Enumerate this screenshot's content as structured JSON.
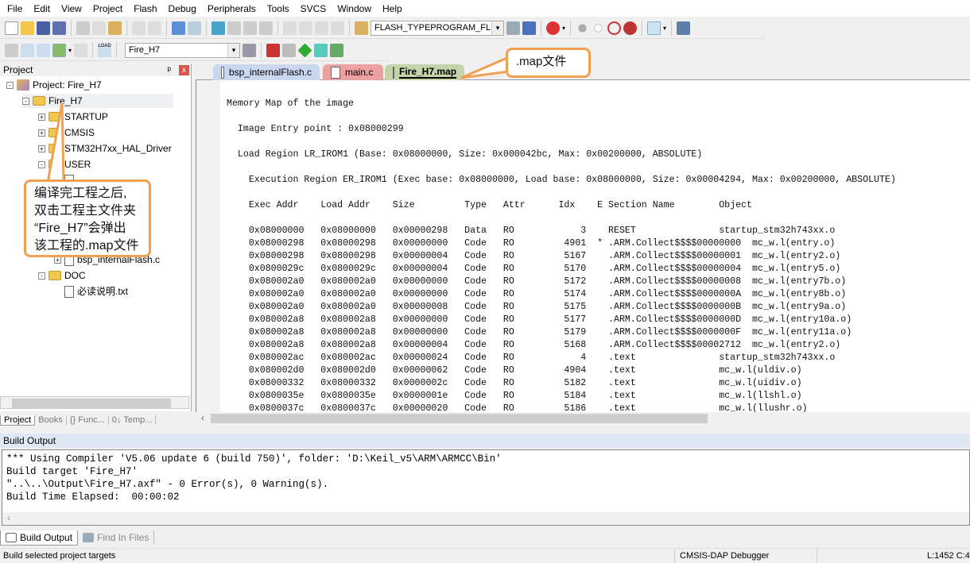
{
  "menu": [
    "File",
    "Edit",
    "View",
    "Project",
    "Flash",
    "Debug",
    "Peripherals",
    "Tools",
    "SVCS",
    "Window",
    "Help"
  ],
  "toolbar": {
    "flash_combo": "FLASH_TYPEPROGRAM_FL",
    "target_combo": "Fire_H7",
    "load_label": "LOAD"
  },
  "project_panel": {
    "title": "Project",
    "close": "x",
    "pin": "ᵖ",
    "items": [
      {
        "label": "Project: Fire_H7",
        "icon": "project-icon",
        "level": 0,
        "exp": "-"
      },
      {
        "label": "Fire_H7",
        "icon": "target-folder-icon",
        "level": 1,
        "exp": "-"
      },
      {
        "label": "STARTUP",
        "icon": "folder-icon",
        "level": 2,
        "exp": "+"
      },
      {
        "label": "CMSIS",
        "icon": "folder-icon",
        "level": 2,
        "exp": "+"
      },
      {
        "label": "STM32H7xx_HAL_Driver",
        "icon": "folder-icon",
        "level": 2,
        "exp": "+"
      },
      {
        "label": "USER",
        "icon": "folder-icon",
        "level": 2,
        "exp": "-"
      },
      {
        "label": "",
        "icon": "file-icon",
        "level": 3,
        "exp": ""
      },
      {
        "label": "",
        "icon": "file-icon",
        "level": 3,
        "exp": ""
      },
      {
        "label": "",
        "icon": "file-icon",
        "level": 3,
        "exp": ""
      },
      {
        "label": "",
        "icon": "file-icon",
        "level": 3,
        "exp": ""
      },
      {
        "label": "t.c",
        "icon": "file-icon",
        "level": 3,
        "exp": "+"
      },
      {
        "label": "bsp_internalFlash.c",
        "icon": "file-icon",
        "level": 3,
        "exp": "+"
      },
      {
        "label": "DOC",
        "icon": "folder-icon",
        "level": 2,
        "exp": "-"
      },
      {
        "label": "必读说明.txt",
        "icon": "file-icon",
        "level": 3,
        "exp": ""
      }
    ],
    "tabs": [
      "Project",
      "Books",
      "{} Func...",
      "0↓ Temp..."
    ]
  },
  "editor": {
    "tabs": [
      {
        "label": "bsp_internalFlash.c",
        "color": "#c9d7ef"
      },
      {
        "label": "main.c",
        "color": "#eda0a0"
      },
      {
        "label": "Fire_H7.map",
        "color": "#c5d3a8"
      }
    ],
    "active_tab": 2,
    "header_lines": [
      "Memory Map of the image",
      "",
      "  Image Entry point : 0x08000299",
      "",
      "  Load Region LR_IROM1 (Base: 0x08000000, Size: 0x000042bc, Max: 0x00200000, ABSOLUTE)",
      "",
      "    Execution Region ER_IROM1 (Exec base: 0x08000000, Load base: 0x08000000, Size: 0x00004294, Max: 0x00200000, ABSOLUTE)",
      "",
      "    Exec Addr    Load Addr    Size         Type   Attr      Idx    E Section Name        Object",
      ""
    ],
    "rows": [
      [
        "0x08000000",
        "0x08000000",
        "0x00000298",
        "Data",
        "RO",
        "3",
        "",
        "RESET",
        "startup_stm32h743xx.o"
      ],
      [
        "0x08000298",
        "0x08000298",
        "0x00000000",
        "Code",
        "RO",
        "4901",
        "*",
        ".ARM.Collect$$$$00000000",
        "mc_w.l(entry.o)"
      ],
      [
        "0x08000298",
        "0x08000298",
        "0x00000004",
        "Code",
        "RO",
        "5167",
        "",
        ".ARM.Collect$$$$00000001",
        "mc_w.l(entry2.o)"
      ],
      [
        "0x0800029c",
        "0x0800029c",
        "0x00000004",
        "Code",
        "RO",
        "5170",
        "",
        ".ARM.Collect$$$$00000004",
        "mc_w.l(entry5.o)"
      ],
      [
        "0x080002a0",
        "0x080002a0",
        "0x00000000",
        "Code",
        "RO",
        "5172",
        "",
        ".ARM.Collect$$$$00000008",
        "mc_w.l(entry7b.o)"
      ],
      [
        "0x080002a0",
        "0x080002a0",
        "0x00000000",
        "Code",
        "RO",
        "5174",
        "",
        ".ARM.Collect$$$$0000000A",
        "mc_w.l(entry8b.o)"
      ],
      [
        "0x080002a0",
        "0x080002a0",
        "0x00000008",
        "Code",
        "RO",
        "5175",
        "",
        ".ARM.Collect$$$$0000000B",
        "mc_w.l(entry9a.o)"
      ],
      [
        "0x080002a8",
        "0x080002a8",
        "0x00000000",
        "Code",
        "RO",
        "5177",
        "",
        ".ARM.Collect$$$$0000000D",
        "mc_w.l(entry10a.o)"
      ],
      [
        "0x080002a8",
        "0x080002a8",
        "0x00000000",
        "Code",
        "RO",
        "5179",
        "",
        ".ARM.Collect$$$$0000000F",
        "mc_w.l(entry11a.o)"
      ],
      [
        "0x080002a8",
        "0x080002a8",
        "0x00000004",
        "Code",
        "RO",
        "5168",
        "",
        ".ARM.Collect$$$$00002712",
        "mc_w.l(entry2.o)"
      ],
      [
        "0x080002ac",
        "0x080002ac",
        "0x00000024",
        "Code",
        "RO",
        "4",
        "",
        ".text",
        "startup_stm32h743xx.o"
      ],
      [
        "0x080002d0",
        "0x080002d0",
        "0x00000062",
        "Code",
        "RO",
        "4904",
        "",
        ".text",
        "mc_w.l(uldiv.o)"
      ],
      [
        "0x08000332",
        "0x08000332",
        "0x0000002c",
        "Code",
        "RO",
        "5182",
        "",
        ".text",
        "mc_w.l(uidiv.o)"
      ],
      [
        "0x0800035e",
        "0x0800035e",
        "0x0000001e",
        "Code",
        "RO",
        "5184",
        "",
        ".text",
        "mc_w.l(llshl.o)"
      ],
      [
        "0x0800037c",
        "0x0800037c",
        "0x00000020",
        "Code",
        "RO",
        "5186",
        "",
        ".text",
        "mc_w.l(llushr.o)"
      ]
    ]
  },
  "build_output": {
    "title": "Build Output",
    "lines": [
      "*** Using Compiler 'V5.06 update 6 (build 750)', folder: 'D:\\Keil_v5\\ARM\\ARMCC\\Bin'",
      "Build target 'Fire_H7'",
      "\"..\\..\\Output\\Fire_H7.axf\" - 0 Error(s), 0 Warning(s).",
      "Build Time Elapsed:  00:00:02"
    ],
    "tabs": [
      "Build Output",
      "Find In Files"
    ]
  },
  "status": {
    "left": "Build selected project targets",
    "debugger": "CMSIS-DAP Debugger",
    "position": "L:1452 C:4"
  },
  "callouts": {
    "tree_note": [
      "编译完工程之后,",
      "双击工程主文件夹",
      "“Fire_H7”会弹出",
      "该工程的.map文件"
    ],
    "tab_note": ".map文件"
  },
  "colors": {
    "callout_border": "#f0a050"
  }
}
